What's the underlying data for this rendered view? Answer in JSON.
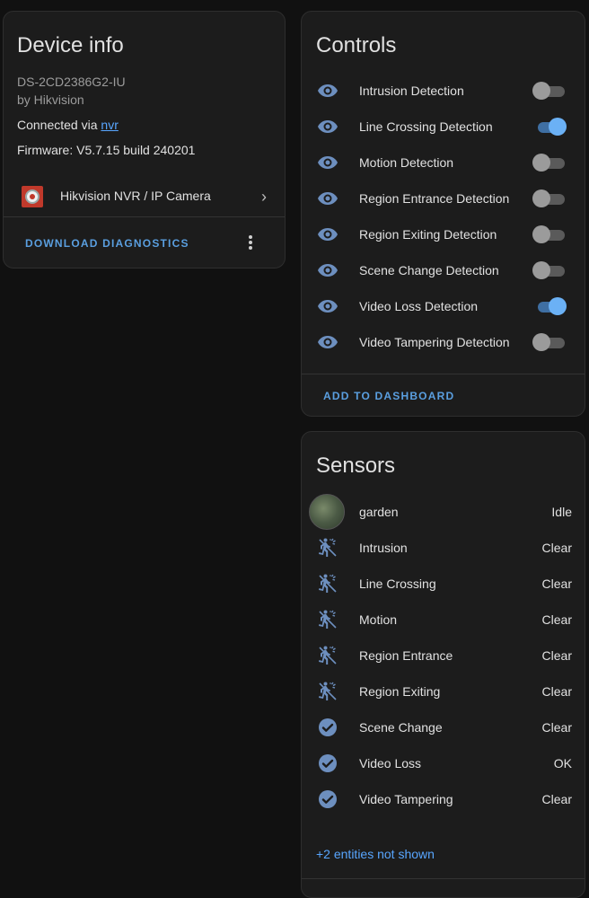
{
  "device": {
    "title": "Device info",
    "model": "DS-2CD2386G2-IU",
    "manufacturer": "by Hikvision",
    "connected_prefix": "Connected via ",
    "connected_link": "nvr",
    "firmware": "Firmware: V5.7.15 build 240201",
    "integration_label": "Hikvision NVR / IP Camera",
    "download_label": "DOWNLOAD DIAGNOSTICS"
  },
  "controls": {
    "title": "Controls",
    "items": [
      {
        "label": "Intrusion Detection",
        "on": false
      },
      {
        "label": "Line Crossing Detection",
        "on": true
      },
      {
        "label": "Motion Detection",
        "on": false
      },
      {
        "label": "Region Entrance Detection",
        "on": false
      },
      {
        "label": "Region Exiting Detection",
        "on": false
      },
      {
        "label": "Scene Change Detection",
        "on": false
      },
      {
        "label": "Video Loss Detection",
        "on": true
      },
      {
        "label": "Video Tampering Detection",
        "on": false
      }
    ],
    "add_label": "ADD TO DASHBOARD"
  },
  "sensors": {
    "title": "Sensors",
    "items": [
      {
        "label": "garden",
        "state": "Idle",
        "icon": "camera-thumbnail"
      },
      {
        "label": "Intrusion",
        "state": "Clear",
        "icon": "walk-off-icon"
      },
      {
        "label": "Line Crossing",
        "state": "Clear",
        "icon": "walk-off-icon"
      },
      {
        "label": "Motion",
        "state": "Clear",
        "icon": "walk-off-icon"
      },
      {
        "label": "Region Entrance",
        "state": "Clear",
        "icon": "walk-off-icon"
      },
      {
        "label": "Region Exiting",
        "state": "Clear",
        "icon": "walk-off-icon"
      },
      {
        "label": "Scene Change",
        "state": "Clear",
        "icon": "check-circle-icon"
      },
      {
        "label": "Video Loss",
        "state": "OK",
        "icon": "check-circle-icon"
      },
      {
        "label": "Video Tampering",
        "state": "Clear",
        "icon": "check-circle-icon"
      }
    ],
    "more_label": "+2 entities not shown"
  },
  "colors": {
    "accent": "#58a6ff",
    "icon": "#6d8fbf",
    "card": "#1c1c1c",
    "background": "#111111"
  }
}
